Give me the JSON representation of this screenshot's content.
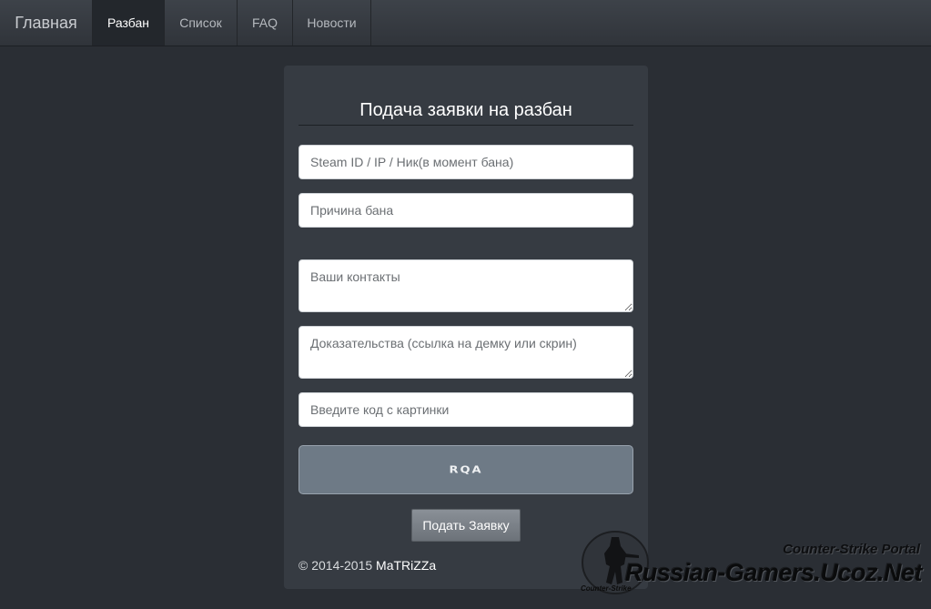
{
  "navbar": {
    "brand": "Главная",
    "items": [
      {
        "label": "Разбан",
        "active": true
      },
      {
        "label": "Список",
        "active": false
      },
      {
        "label": "FAQ",
        "active": false
      },
      {
        "label": "Новости",
        "active": false
      }
    ]
  },
  "form": {
    "title": "Подача заявки на разбан",
    "steam_placeholder": "Steam ID / IP / Ник(в момент бана)",
    "reason_placeholder": "Причина бана",
    "contacts_placeholder": "Ваши контакты",
    "evidence_placeholder": "Доказательства (ссылка на демку или скрин)",
    "captcha_placeholder": "Введите код с картинки",
    "captcha_text": "RQA",
    "submit_label": "Подать Заявку"
  },
  "footer": {
    "copyright": "© 2014-2015",
    "author": "MaTRiZZa"
  },
  "watermark": {
    "portal": "Counter-Strike Portal",
    "site": "Russian-Gamers.Ucoz.Net",
    "logo_text": "Counter-Strike"
  },
  "colors": {
    "background": "#2a2e34",
    "panel": "#363b42",
    "captcha": "#6e7a86",
    "button": "#7a8087"
  }
}
